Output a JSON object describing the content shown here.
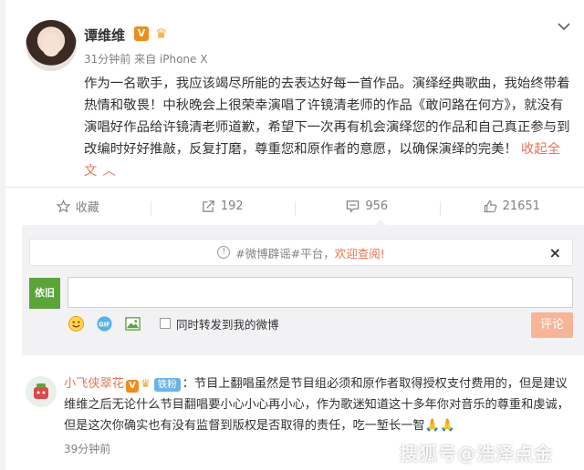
{
  "post": {
    "username": "谭维维",
    "verified_badge": "V",
    "time_source": "31分钟前 来自 iPhone X",
    "text": "作为一名歌手，我应该竭尽所能的去表达好每一首作品。演绎经典歌曲，我始终带着热情和敬畏！中秋晚会上很荣幸演唱了许镜清老师的作品《敢问路在何方》，就没有演唱好作品给许镜清老师道歉，希望下一次再有机会演绎您的作品和自己真正参与到改编时好好推敲，反复打磨，尊重您和原作者的意愿，以确保演绎的完美！",
    "collapse_label": "收起全文"
  },
  "actions": {
    "favorite_label": "收藏",
    "repost_count": "192",
    "comment_count": "956",
    "like_count": "21651"
  },
  "notice": {
    "tag": "#微博辟谣#平台，",
    "welcome": "欢迎查阅!"
  },
  "composer": {
    "avatar_text": "依旧",
    "forward_label": "同时转发到我的微博",
    "submit_label": "评论"
  },
  "reply": {
    "name": "小飞侠翠花",
    "verified_badge": "V",
    "fan_badge": "铁粉",
    "text": "节目上翻唱虽然是节目组必须和原作者取得授权支付费用的，但是建议维维之后无论什么节目翻唱要小心小心再小心，作为歌迷知道这十多年你对音乐的尊重和虔诚，但是这次你确实也有没有监督到版权是否取得的责任，吃一堑长一智🙏🙏",
    "time": "39分钟前"
  },
  "watermark": "搜狐号@浩泽点金",
  "icons": [
    "chevron-down-icon",
    "star-icon",
    "repost-icon",
    "comment-icon",
    "like-icon",
    "info-icon",
    "close-icon",
    "emoji-icon",
    "gif-icon",
    "image-icon",
    "crown-icon"
  ],
  "colors": {
    "accent": "#eb7350",
    "badge": "#f28c16",
    "fan_badge": "#6cb2e8",
    "submit_disabled": "#f7b497"
  }
}
